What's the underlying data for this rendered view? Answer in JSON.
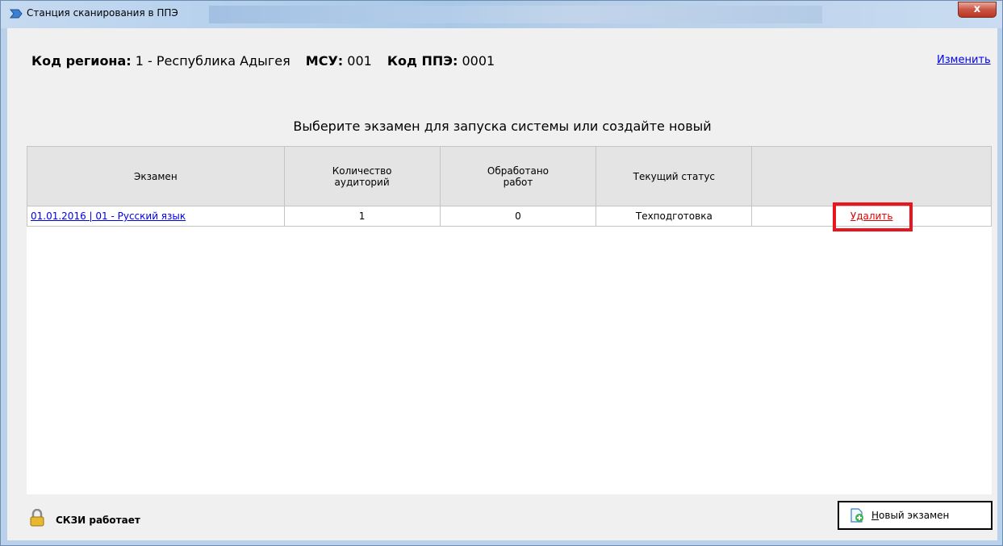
{
  "window": {
    "title": "Станция сканирования в ППЭ",
    "close_label": "x"
  },
  "header": {
    "region_label": "Код региона:",
    "region_value": "1 - Республика Адыгея",
    "msu_label": "МСУ:",
    "msu_value": "001",
    "ppe_label": "Код ППЭ:",
    "ppe_value": "0001",
    "change_link": "Изменить"
  },
  "main": {
    "subtitle": "Выберите экзамен для запуска системы или создайте новый",
    "columns": [
      "Экзамен",
      "Количество аудиторий",
      "Обработано работ",
      "Текущий статус",
      ""
    ],
    "rows": [
      {
        "exam": "01.01.2016 | 01 - Русский язык",
        "rooms": "1",
        "processed": "0",
        "status": "Техподготовка",
        "action": "Удалить"
      }
    ]
  },
  "footer": {
    "status_text": "СКЗИ работает",
    "status_icon": "lock-icon",
    "new_exam_first_letter": "Н",
    "new_exam_rest": "овый экзамен",
    "new_exam_icon": "add-document-icon"
  },
  "colors": {
    "highlight_box": "#e8141e",
    "link": "#0000ee",
    "delete_link": "#e00000"
  }
}
